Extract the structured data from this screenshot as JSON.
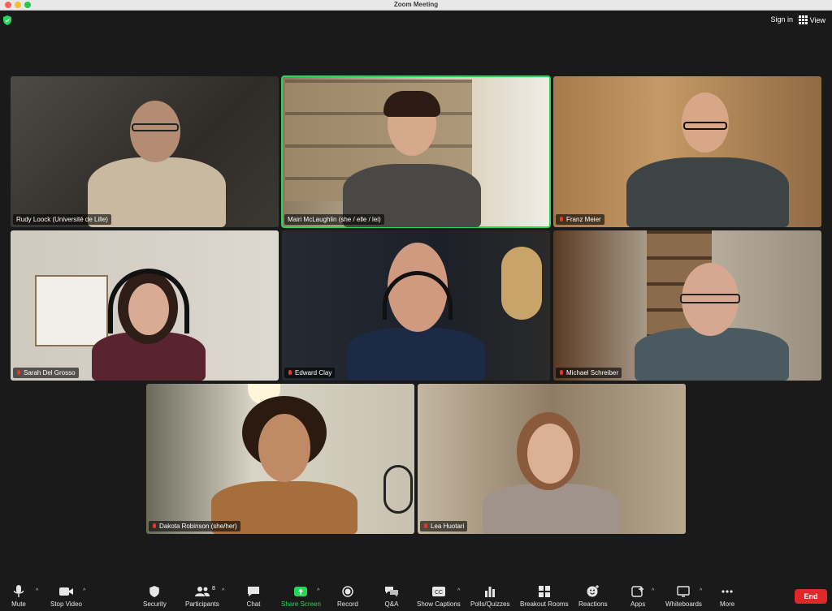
{
  "window": {
    "title": "Zoom Meeting"
  },
  "topbar": {
    "sign_in": "Sign in",
    "view": "View"
  },
  "participants": [
    {
      "name": "Rudy Loock (Université de Lille)",
      "muted": false,
      "speaking": false
    },
    {
      "name": "Mairi McLaughlin (she / elle / lei)",
      "muted": false,
      "speaking": true
    },
    {
      "name": "Franz Meier",
      "muted": true,
      "speaking": false
    },
    {
      "name": "Sarah Del Grosso",
      "muted": true,
      "speaking": false
    },
    {
      "name": "Edward Clay",
      "muted": true,
      "speaking": false
    },
    {
      "name": "Michael Schreiber",
      "muted": true,
      "speaking": false
    },
    {
      "name": "Dakota Robinson (she/her)",
      "muted": true,
      "speaking": false
    },
    {
      "name": "Lea Huotari",
      "muted": true,
      "speaking": false
    }
  ],
  "toolbar": {
    "mute": "Mute",
    "stop_video": "Stop Video",
    "security": "Security",
    "participants": "Participants",
    "participants_count": "8",
    "chat": "Chat",
    "share_screen": "Share Screen",
    "record": "Record",
    "qa": "Q&A",
    "show_captions": "Show Captions",
    "polls": "Polls/Quizzes",
    "breakout": "Breakout Rooms",
    "reactions": "Reactions",
    "apps": "Apps",
    "whiteboards": "Whiteboards",
    "more": "More",
    "end": "End"
  },
  "colors": {
    "accent_green": "#23d959",
    "end_red": "#e02828",
    "background": "#1a1a1a"
  }
}
